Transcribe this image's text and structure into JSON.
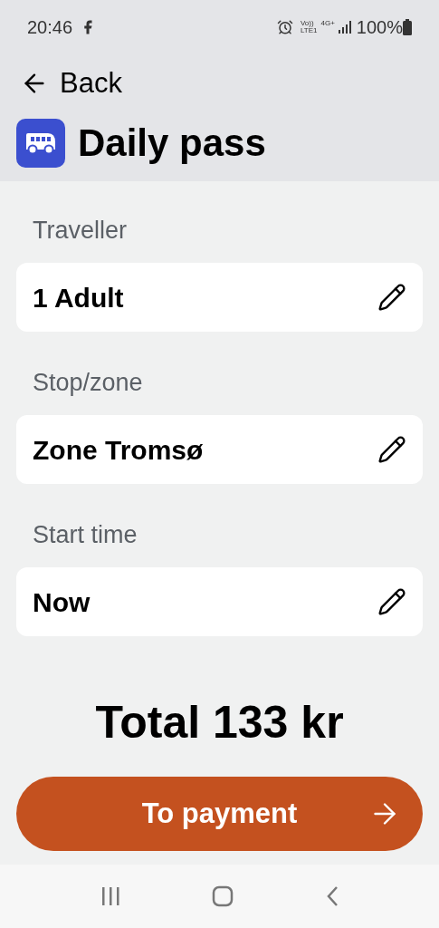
{
  "status_bar": {
    "time": "20:46",
    "network": [
      "Vo))",
      "LTE1",
      "4G+"
    ],
    "battery": "100%"
  },
  "header": {
    "back": "Back",
    "title": "Daily pass"
  },
  "fields": [
    {
      "label": "Traveller",
      "value": "1 Adult"
    },
    {
      "label": "Stop/zone",
      "value": "Zone Tromsø"
    },
    {
      "label": "Start time",
      "value": "Now"
    }
  ],
  "total": "Total 133 kr",
  "payment_button": "To payment"
}
